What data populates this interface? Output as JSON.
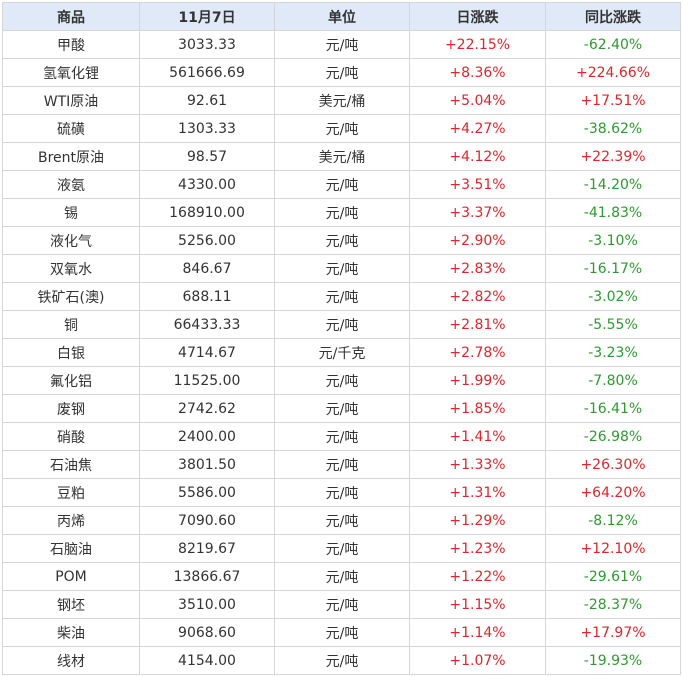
{
  "header": {
    "commodity": "商品",
    "date": "11月7日",
    "unit": "单位",
    "daily_change": "日涨跌",
    "yoy_change": "同比涨跌"
  },
  "colors": {
    "up": "#e0262b",
    "down": "#2f9a2f",
    "header_bg": "#dfe9f7"
  },
  "rows": [
    {
      "name": "甲酸",
      "price": "3033.33",
      "unit": "元/吨",
      "daily": "+22.15%",
      "yoy": "-62.40%"
    },
    {
      "name": "氢氧化锂",
      "price": "561666.69",
      "unit": "元/吨",
      "daily": "+8.36%",
      "yoy": "+224.66%"
    },
    {
      "name": "WTI原油",
      "price": "92.61",
      "unit": "美元/桶",
      "daily": "+5.04%",
      "yoy": "+17.51%"
    },
    {
      "name": "硫磺",
      "price": "1303.33",
      "unit": "元/吨",
      "daily": "+4.27%",
      "yoy": "-38.62%"
    },
    {
      "name": "Brent原油",
      "price": "98.57",
      "unit": "美元/桶",
      "daily": "+4.12%",
      "yoy": "+22.39%"
    },
    {
      "name": "液氨",
      "price": "4330.00",
      "unit": "元/吨",
      "daily": "+3.51%",
      "yoy": "-14.20%"
    },
    {
      "name": "锡",
      "price": "168910.00",
      "unit": "元/吨",
      "daily": "+3.37%",
      "yoy": "-41.83%"
    },
    {
      "name": "液化气",
      "price": "5256.00",
      "unit": "元/吨",
      "daily": "+2.90%",
      "yoy": "-3.10%"
    },
    {
      "name": "双氧水",
      "price": "846.67",
      "unit": "元/吨",
      "daily": "+2.83%",
      "yoy": "-16.17%"
    },
    {
      "name": "铁矿石(澳)",
      "price": "688.11",
      "unit": "元/吨",
      "daily": "+2.82%",
      "yoy": "-3.02%"
    },
    {
      "name": "铜",
      "price": "66433.33",
      "unit": "元/吨",
      "daily": "+2.81%",
      "yoy": "-5.55%"
    },
    {
      "name": "白银",
      "price": "4714.67",
      "unit": "元/千克",
      "daily": "+2.78%",
      "yoy": "-3.23%"
    },
    {
      "name": "氟化铝",
      "price": "11525.00",
      "unit": "元/吨",
      "daily": "+1.99%",
      "yoy": "-7.80%"
    },
    {
      "name": "废钢",
      "price": "2742.62",
      "unit": "元/吨",
      "daily": "+1.85%",
      "yoy": "-16.41%"
    },
    {
      "name": "硝酸",
      "price": "2400.00",
      "unit": "元/吨",
      "daily": "+1.41%",
      "yoy": "-26.98%"
    },
    {
      "name": "石油焦",
      "price": "3801.50",
      "unit": "元/吨",
      "daily": "+1.33%",
      "yoy": "+26.30%"
    },
    {
      "name": "豆粕",
      "price": "5586.00",
      "unit": "元/吨",
      "daily": "+1.31%",
      "yoy": "+64.20%"
    },
    {
      "name": "丙烯",
      "price": "7090.60",
      "unit": "元/吨",
      "daily": "+1.29%",
      "yoy": "-8.12%"
    },
    {
      "name": "石脑油",
      "price": "8219.67",
      "unit": "元/吨",
      "daily": "+1.23%",
      "yoy": "+12.10%"
    },
    {
      "name": "POM",
      "price": "13866.67",
      "unit": "元/吨",
      "daily": "+1.22%",
      "yoy": "-29.61%"
    },
    {
      "name": "钢坯",
      "price": "3510.00",
      "unit": "元/吨",
      "daily": "+1.15%",
      "yoy": "-28.37%"
    },
    {
      "name": "柴油",
      "price": "9068.60",
      "unit": "元/吨",
      "daily": "+1.14%",
      "yoy": "+17.97%"
    },
    {
      "name": "线材",
      "price": "4154.00",
      "unit": "元/吨",
      "daily": "+1.07%",
      "yoy": "-19.93%"
    }
  ]
}
